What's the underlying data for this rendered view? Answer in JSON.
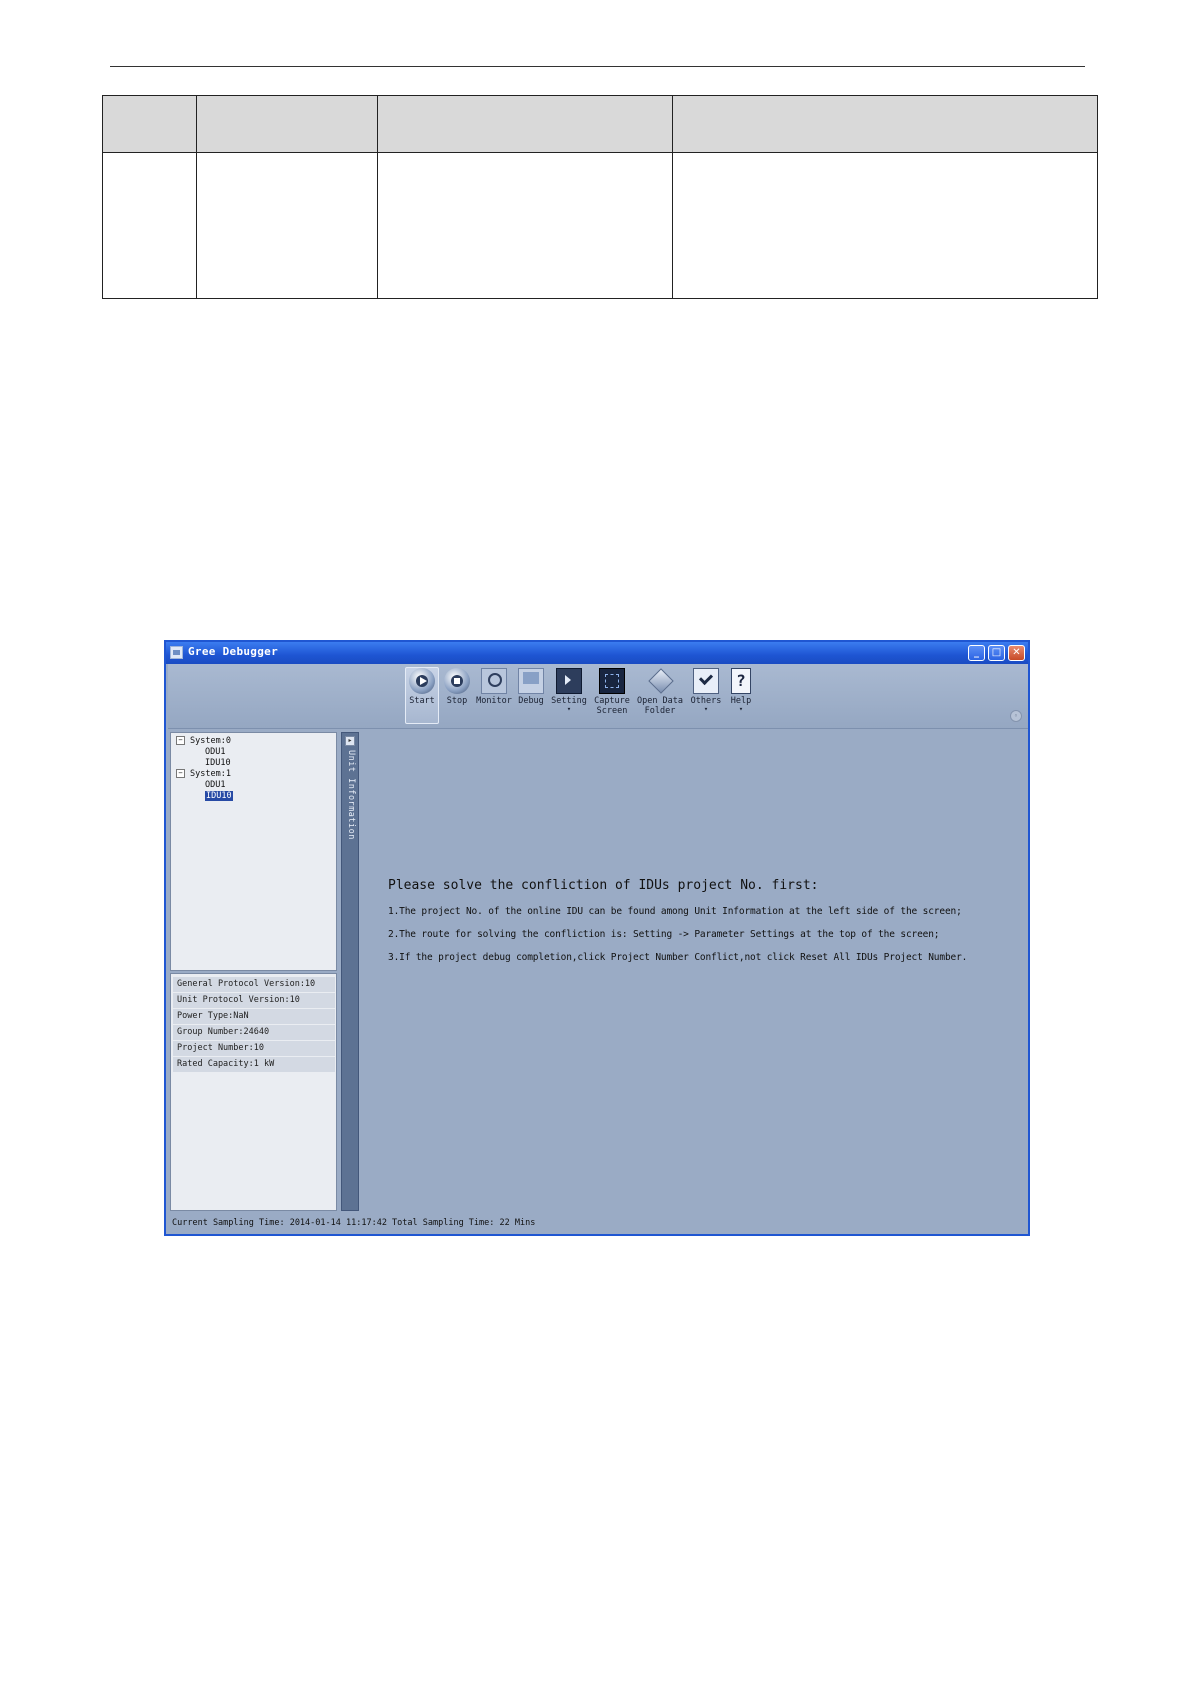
{
  "window": {
    "title": "Gree Debugger",
    "controls": [
      "minimize",
      "maximize",
      "close"
    ]
  },
  "toolbar": {
    "items": [
      {
        "label": "Start",
        "icon": "play-icon"
      },
      {
        "label": "Stop",
        "icon": "stop-icon"
      },
      {
        "label": "Monitor",
        "icon": "monitor-magnifier-icon"
      },
      {
        "label": "Debug",
        "icon": "computer-icon"
      },
      {
        "label": "Setting",
        "icon": "cursor-icon",
        "has_dropdown": true
      },
      {
        "label": "Capture\nScreen",
        "icon": "capture-icon"
      },
      {
        "label": "Open Data\nFolder",
        "icon": "diamond-folder-icon"
      },
      {
        "label": "Others",
        "icon": "check-icon",
        "has_dropdown": true
      },
      {
        "label": "Help",
        "icon": "help-icon",
        "has_dropdown": true
      }
    ]
  },
  "tree": {
    "systems": [
      {
        "label": "System:0",
        "children": [
          "ODU1",
          "IDU10"
        ]
      },
      {
        "label": "System:1",
        "children": [
          "ODU1",
          "IDU10"
        ]
      }
    ],
    "selected": "IDU10"
  },
  "side_tab": {
    "label": "Unit Information"
  },
  "unit_info": [
    "General Protocol Version:10",
    "Unit Protocol Version:10",
    "Power Type:NaN",
    "Group Number:24640",
    "Project Number:10",
    "Rated Capacity:1 kW"
  ],
  "message": {
    "headline": "Please solve the confliction of IDUs project No. first:",
    "lines": [
      "1.The project No. of the online IDU can be found among Unit Information at the left side of the screen;",
      "2.The route for solving the confliction is: Setting -> Parameter Settings at the top of the screen;",
      "3.If the project debug completion,click Project Number Conflict,not click Reset All IDUs Project Number."
    ]
  },
  "status": {
    "text": "Current Sampling Time: 2014-01-14 11:17:42  Total Sampling Time: 22 Mins"
  },
  "colors": {
    "titlebar": "#1e55d3",
    "workspace": "#9aabc5",
    "selection": "#274aa5"
  }
}
